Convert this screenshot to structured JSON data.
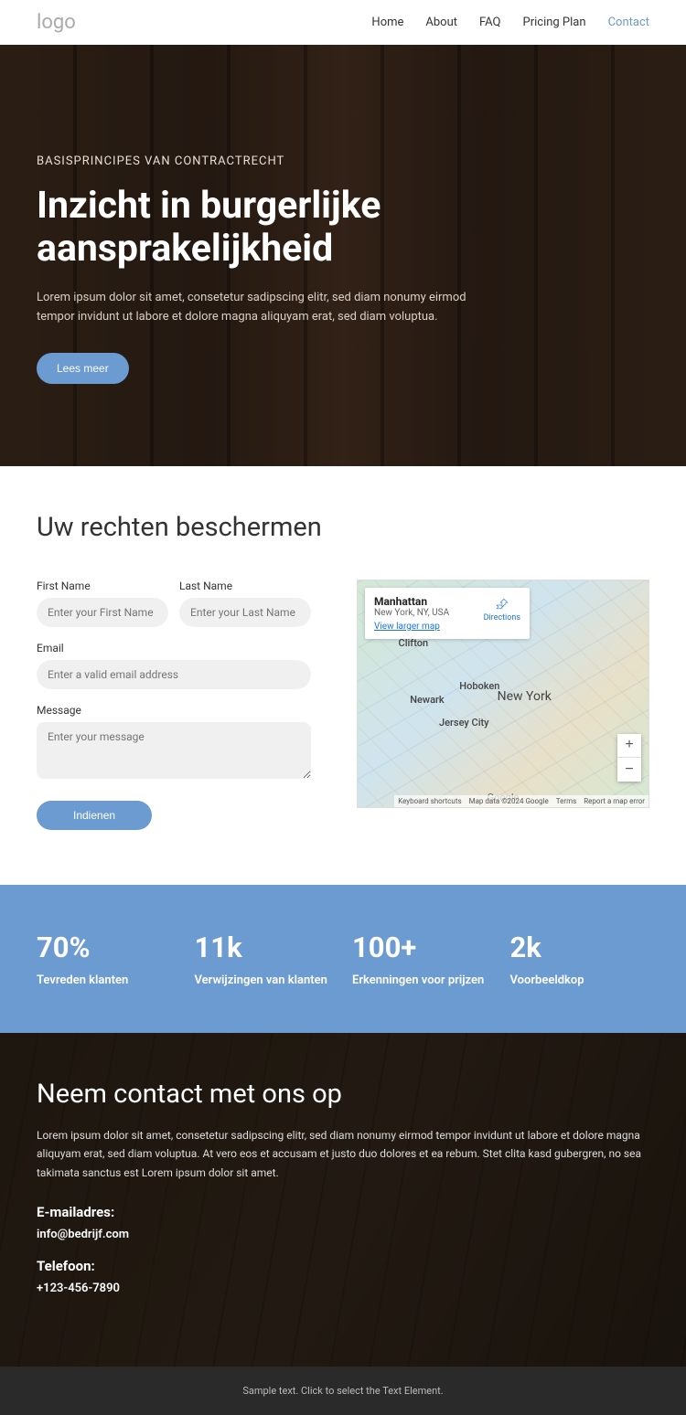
{
  "header": {
    "logo": "logo",
    "nav": [
      "Home",
      "About",
      "FAQ",
      "Pricing Plan",
      "Contact"
    ]
  },
  "hero": {
    "overline": "BASISPRINCIPES VAN CONTRACTRECHT",
    "title": "Inzicht in burgerlijke aansprakelijkheid",
    "desc": "Lorem ipsum dolor sit amet, consetetur sadipscing elitr, sed diam nonumy eirmod tempor invidunt ut labore et dolore magna aliquyam erat, sed diam voluptua.",
    "cta": "Lees meer"
  },
  "contact_section": {
    "title": "Uw rechten beschermen",
    "form": {
      "first_name_label": "First Name",
      "first_name_placeholder": "Enter your First Name",
      "last_name_label": "Last Name",
      "last_name_placeholder": "Enter your Last Name",
      "email_label": "Email",
      "email_placeholder": "Enter a valid email address",
      "message_label": "Message",
      "message_placeholder": "Enter your message",
      "submit": "Indienen"
    },
    "map": {
      "info_title": "Manhattan",
      "info_sub": "New York, NY, USA",
      "view_larger": "View larger map",
      "directions": "Directions",
      "cities": {
        "ny": "New York",
        "newark": "Newark",
        "clifton": "Clifton",
        "hoboken": "Hoboken",
        "jersey": "Jersey City"
      },
      "footer": {
        "shortcuts": "Keyboard shortcuts",
        "data": "Map data ©2024 Google",
        "terms": "Terms",
        "report": "Report a map error"
      },
      "google": "Google"
    }
  },
  "stats": [
    {
      "num": "70%",
      "lbl": "Tevreden klanten"
    },
    {
      "num": "11k",
      "lbl": "Verwijzingen van klanten"
    },
    {
      "num": "100+",
      "lbl": "Erkenningen voor prijzen"
    },
    {
      "num": "2k",
      "lbl": "Voorbeeldkop"
    }
  ],
  "contact_info": {
    "title": "Neem contact met ons op",
    "desc": "Lorem ipsum dolor sit amet, consetetur sadipscing elitr, sed diam nonumy eirmod tempor invidunt ut labore et dolore magna aliquyam erat, sed diam voluptua. At vero eos et accusam et justo duo dolores et ea rebum. Stet clita kasd gubergren, no sea takimata sanctus est Lorem ipsum dolor sit amet.",
    "email_label": "E-mailadres:",
    "email": "info@bedrijf.com",
    "phone_label": "Telefoon:",
    "phone": "+123-456-7890"
  },
  "footer": {
    "text": "Sample text. Click to select the Text Element."
  }
}
